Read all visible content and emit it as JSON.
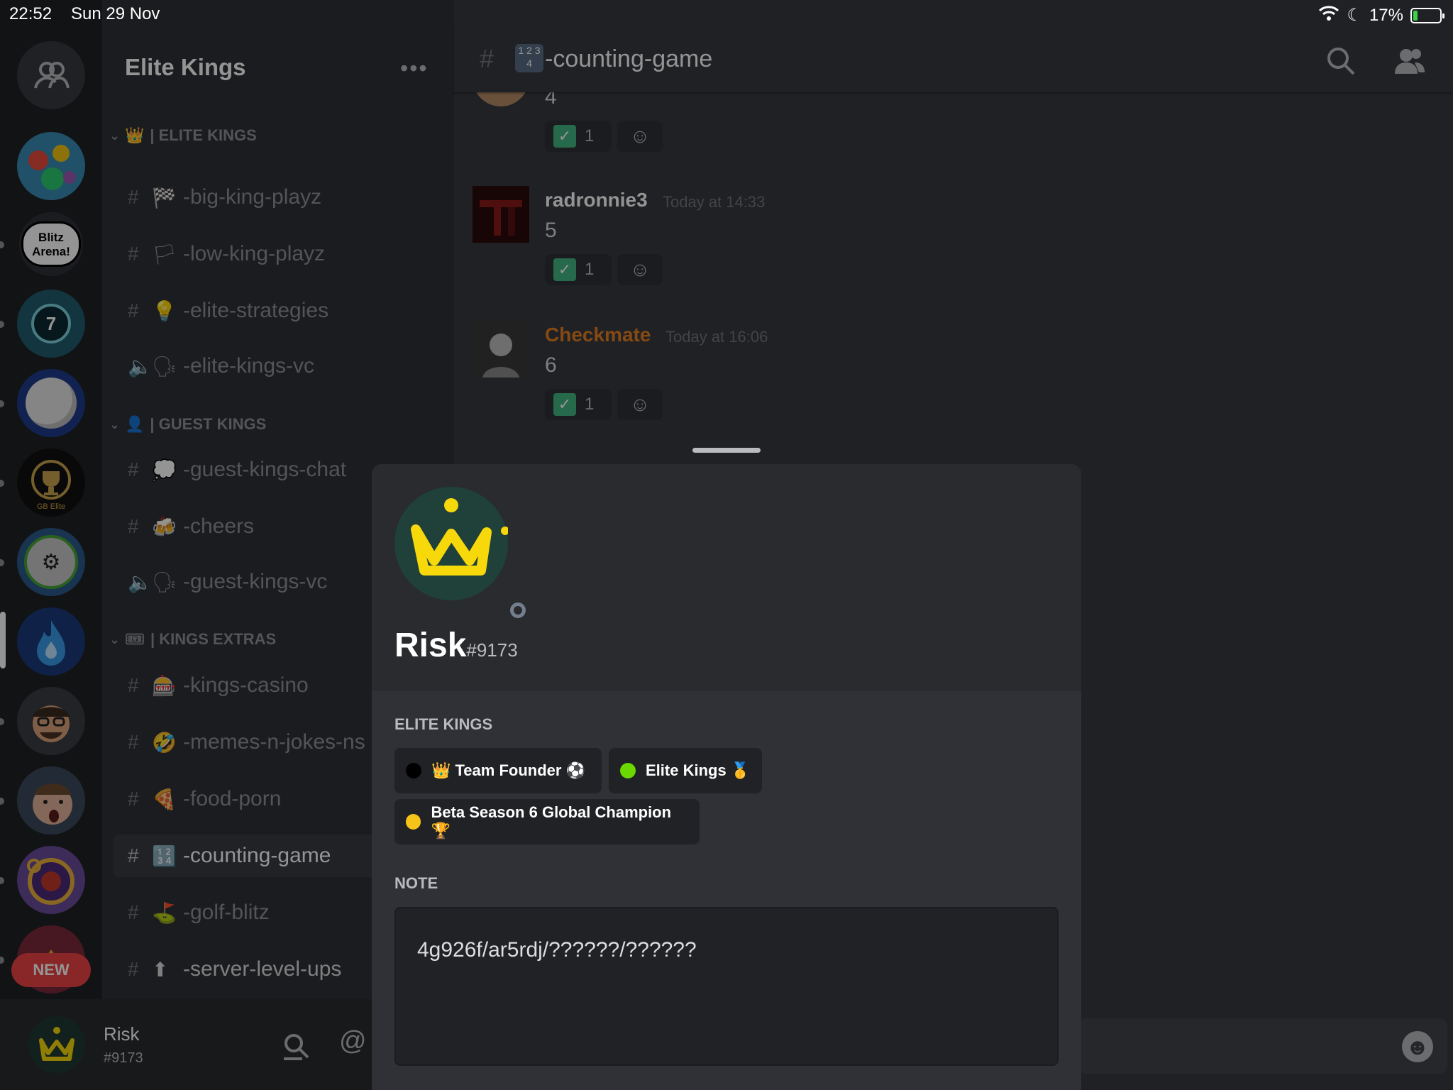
{
  "status_bar": {
    "time": "22:52",
    "date": "Sun 29 Nov",
    "battery": "17%",
    "battery_level": 0.17
  },
  "server": {
    "name": "Elite Kings",
    "more_label": "•••",
    "new_badge": "NEW",
    "rail_icons": [
      {
        "name": "direct-messages-icon",
        "color": "#36393f"
      },
      {
        "name": "server-art-icon",
        "color": "#3a8ab5"
      },
      {
        "name": "blitz-arena-icon",
        "label": "Blitz Arena!",
        "color": "#2f3136"
      },
      {
        "name": "badge-7-icon",
        "label": "7",
        "color": "#1f5c6e"
      },
      {
        "name": "golf-ball-icon",
        "color": "#1e3c8c"
      },
      {
        "name": "gb-elite-trophy-icon",
        "label": "GB Elite",
        "color": "#111111"
      },
      {
        "name": "soccer-ball-icon",
        "color": "#2a5a8a"
      },
      {
        "name": "blue-flame-icon",
        "color": "#1a3a7a"
      },
      {
        "name": "memoji-avatar-icon",
        "color": "#3a3d44"
      },
      {
        "name": "surprised-face-icon",
        "color": "#5a4a44"
      },
      {
        "name": "gem-ring-icon",
        "color": "#6a4a9a"
      },
      {
        "name": "crown-server-icon",
        "color": "#7a2a3a"
      }
    ]
  },
  "categories": [
    {
      "emoji": "👑",
      "label": "| ELITE KINGS"
    },
    {
      "emoji": "👤",
      "label": "| GUEST KINGS"
    },
    {
      "emoji": "🎟",
      "label": "| KINGS EXTRAS"
    }
  ],
  "channels": [
    {
      "emoji": "🏁",
      "name": "-big-king-playz",
      "type": "text"
    },
    {
      "emoji": "🏳",
      "name": "-low-king-playz",
      "type": "text"
    },
    {
      "emoji": "💡",
      "name": "-elite-strategies",
      "type": "text"
    },
    {
      "emoji": "🗣",
      "name": "-elite-kings-vc",
      "type": "voice"
    },
    {
      "emoji": "💭",
      "name": "-guest-kings-chat",
      "type": "text"
    },
    {
      "emoji": "🍻",
      "name": "-cheers",
      "type": "text"
    },
    {
      "emoji": "🗣",
      "name": "-guest-kings-vc",
      "type": "voice"
    },
    {
      "emoji": "🎰",
      "name": "-kings-casino",
      "type": "text"
    },
    {
      "emoji": "🤣",
      "name": "-memes-n-jokes-ns",
      "type": "text"
    },
    {
      "emoji": "🍕",
      "name": "-food-porn",
      "type": "text"
    },
    {
      "emoji": "🔢",
      "name": "-counting-game",
      "type": "text",
      "active": true
    },
    {
      "emoji": "⛳",
      "name": "-golf-blitz",
      "type": "text"
    },
    {
      "emoji": "⬆",
      "name": "-server-level-ups",
      "type": "text"
    }
  ],
  "current_user": {
    "name": "Risk",
    "tag": "#9173"
  },
  "chat": {
    "channel_title": "-counting-game",
    "channel_badge": "1 2 3 4",
    "messages": [
      {
        "author": "",
        "timestamp": "",
        "text": "4",
        "reaction_count": "1",
        "author_color": "#ffffff"
      },
      {
        "author": "radronnie3",
        "timestamp": "Today at 14:33",
        "text": "5",
        "reaction_count": "1",
        "author_color": "#ffffff"
      },
      {
        "author": "Checkmate",
        "timestamp": "Today at 16:06",
        "text": "6",
        "reaction_count": "1",
        "author_color": "#e67e22"
      }
    ]
  },
  "profile": {
    "username": "Risk",
    "discriminator": "#9173",
    "section_roles": "ELITE KINGS",
    "roles": [
      {
        "label": "👑 Team Founder ⚽",
        "color": "#000000"
      },
      {
        "label": "Elite Kings 🥇",
        "color": "#6bd900"
      },
      {
        "label": "Beta Season 6 Global Champion 🏆",
        "color": "#f6c419"
      }
    ],
    "section_note": "NOTE",
    "note": "4g926f/ar5rdj/??????/??????"
  },
  "colors": {
    "accent_yellow": "#f6d80b",
    "avatar_bg": "#20403a"
  }
}
